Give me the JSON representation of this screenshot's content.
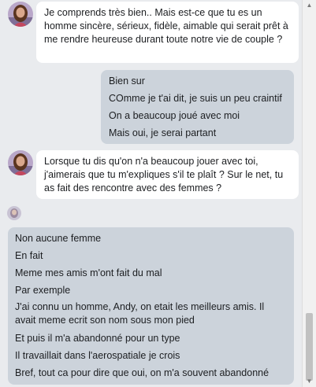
{
  "messages": [
    {
      "from": "contact",
      "text": "Je comprends très bien.. Mais est-ce que tu es un homme sincère, sérieux, fidèle, aimable qui serait prêt à me rendre heureuse durant toute notre vie de couple ?"
    },
    {
      "from": "me",
      "lines": [
        "Bien sur",
        "COmme je t'ai dit, je suis un peu craintif",
        "On a beaucoup joué avec moi",
        "Mais oui, je serai partant"
      ]
    },
    {
      "from": "contact",
      "text": "Lorsque tu dis qu'on n'a beaucoup jouer avec toi, j'aimerais que tu m'expliques s'il te plaît ? Sur le net, tu as fait des rencontre avec des femmes ?"
    },
    {
      "from": "me",
      "lines": [
        "Non aucune femme",
        "En fait",
        "Meme mes amis m'ont fait du mal",
        "Par exemple",
        "J'ai connu un homme, Andy, on etait les meilleurs amis. Il avait meme ecrit son nom sous mon pied",
        "Et puis il m'a abandonné pour un type",
        "Il travaillait dans l'aerospatiale je crois",
        "Bref, tout ca pour dire que oui, on m'a souvent abandonné"
      ]
    }
  ],
  "colors": {
    "background": "#e9ebee",
    "incoming_bubble": "#ffffff",
    "outgoing_bubble": "#ccd3db"
  }
}
